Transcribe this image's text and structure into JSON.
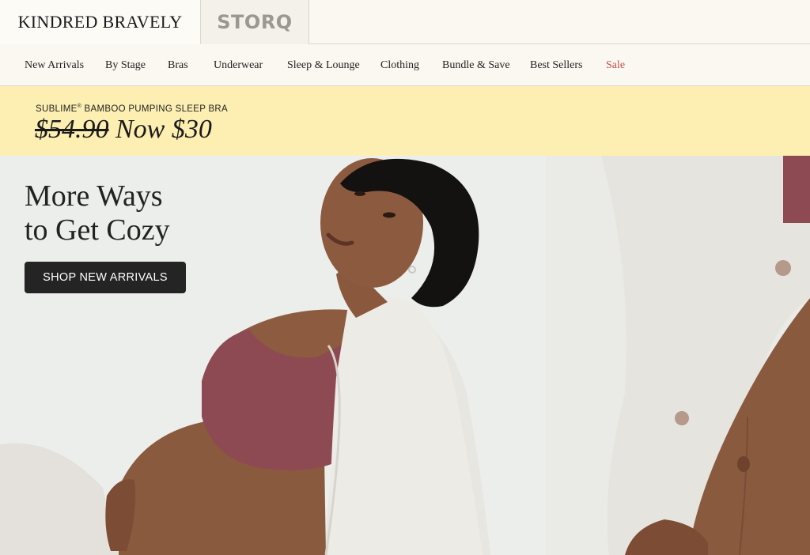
{
  "brands": {
    "kindred": "KINDRED BRAVELY",
    "storq": "STORQ"
  },
  "nav": {
    "items": [
      "New Arrivals",
      "By Stage",
      "Bras",
      "Underwear",
      "Sleep & Lounge",
      "Clothing",
      "Bundle & Save",
      "Best Sellers",
      "Sale"
    ]
  },
  "promo": {
    "product_name": "SUBLIME",
    "trademark": "®",
    "product_rest": " BAMBOO PUMPING SLEEP BRA",
    "old_price": "$54.90",
    "new_price": " Now $30"
  },
  "hero": {
    "title": "More Ways\nto Get Cozy",
    "cta": "SHOP NEW ARRIVALS"
  },
  "colors": {
    "promo_bg": "#fdefb2",
    "sale": "#c2504a",
    "cta_bg": "#242424"
  }
}
